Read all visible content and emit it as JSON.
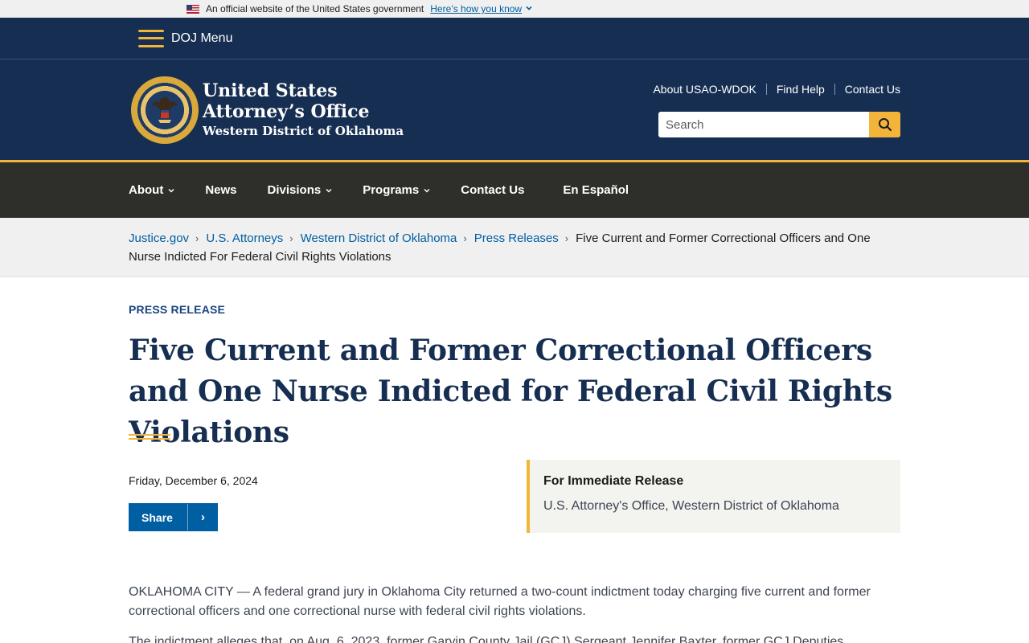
{
  "gov_banner": {
    "text": "An official website of the United States government",
    "link": "Here’s how you know"
  },
  "doj_menu": {
    "label": "DOJ Menu"
  },
  "header": {
    "title_line1": "United States",
    "title_line2": "Attorney’s Office",
    "title_line3": "Western District of Oklahoma",
    "util_links": [
      "About USAO-WDOK",
      "Find Help",
      "Contact Us"
    ],
    "search_placeholder": "Search"
  },
  "nav": {
    "items": [
      {
        "label": "About",
        "dropdown": true
      },
      {
        "label": "News",
        "dropdown": false
      },
      {
        "label": "Divisions",
        "dropdown": true
      },
      {
        "label": "Programs",
        "dropdown": true
      },
      {
        "label": "Contact Us",
        "dropdown": false
      },
      {
        "label": "En Español",
        "dropdown": false
      }
    ]
  },
  "breadcrumb": {
    "links": [
      "Justice.gov",
      "U.S. Attorneys",
      "Western District of Oklahoma",
      "Press Releases"
    ],
    "current": "Five Current and Former Correctional Officers and One Nurse Indicted For Federal Civil Rights Violations"
  },
  "article": {
    "eyebrow": "PRESS RELEASE",
    "title": "Five Current and Former Correctional Officers and One Nurse Indicted for Federal Civil Rights Violations",
    "date": "Friday, December 6, 2024",
    "share_label": "Share",
    "release_heading": "For Immediate Release",
    "release_office": "U.S. Attorney's Office, Western District of Oklahoma",
    "paragraphs": [
      "OKLAHOMA CITY — A federal grand jury in Oklahoma City returned a two-count indictment today charging five current and former correctional officers and one correctional nurse with federal civil rights violations.",
      "The indictment alleges that, on Aug. 6, 2023, former Garvin County Jail (GCJ) Sergeant Jennifer Baxter, former GCJ Deputies"
    ]
  },
  "colors": {
    "navy": "#162e51",
    "gold": "#f2b53a",
    "nav_dark": "#2e2e2a",
    "link_blue": "#005ea2"
  }
}
